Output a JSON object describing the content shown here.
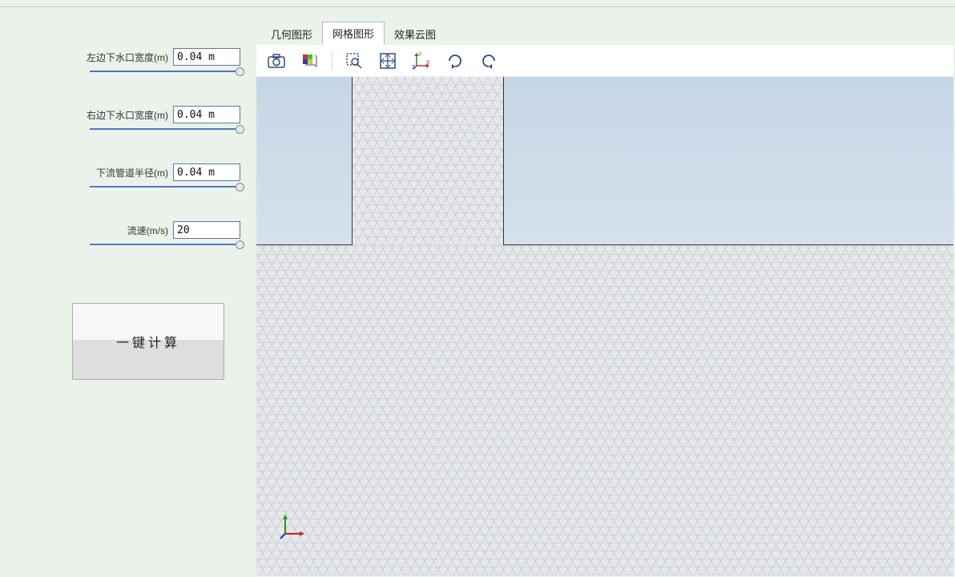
{
  "sidebar": {
    "params": [
      {
        "label": "左边下水口宽度(m)",
        "value": "0.04 m"
      },
      {
        "label": "右边下水口宽度(m)",
        "value": "0.04 m"
      },
      {
        "label": "下流管道半径(m)",
        "value": "0.04 m"
      },
      {
        "label": "流速(m/s)",
        "value": "20"
      }
    ],
    "calc_button": "一键计算"
  },
  "tabs": {
    "items": [
      {
        "label": "几何图形",
        "active": false
      },
      {
        "label": "网格图形",
        "active": true
      },
      {
        "label": "效果云图",
        "active": false
      }
    ]
  },
  "toolbar": {
    "icons": [
      "camera-icon",
      "transparency-icon",
      "zoom-box-icon",
      "fit-screen-icon",
      "axis-orient-icon",
      "rotate-right-icon",
      "rotate-left-icon"
    ]
  }
}
